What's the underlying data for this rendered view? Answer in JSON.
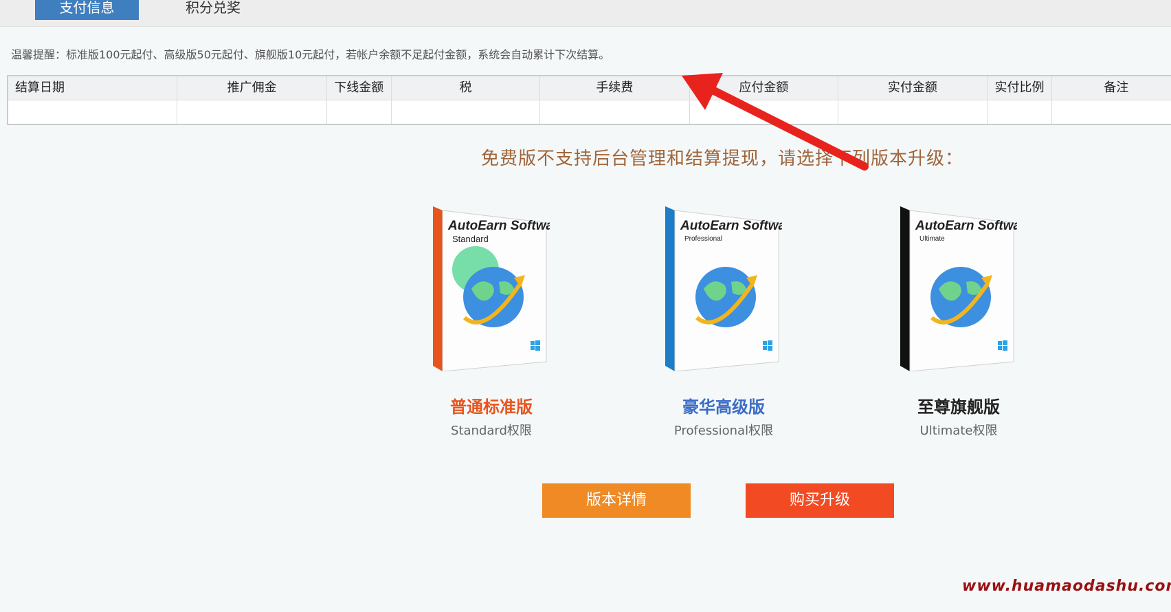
{
  "tabs": {
    "active_label": "支付信息",
    "inactive_label": "积分兑奖"
  },
  "notice": "温馨提醒：标准版100元起付、高级版50元起付、旗舰版10元起付，若帐户余额不足起付金额，系统会自动累计下次结算。",
  "table": {
    "columns": [
      "结算日期",
      "推广佣金",
      "下线金额",
      "税",
      "手续费",
      "应付金额",
      "实付金额",
      "实付比例",
      "备注"
    ]
  },
  "headline": "免费版不支持后台管理和结算提现，请选择下列版本升级：",
  "products": [
    {
      "brand": "AutoEarn Software",
      "edition": "Standard",
      "name": "普通标准版",
      "subtitle": "Standard权限",
      "spine_color": "#e8541e",
      "name_color": "#e8541e"
    },
    {
      "brand": "AutoEarn Software",
      "edition": "Professional",
      "name": "豪华高级版",
      "subtitle": "Professional权限",
      "spine_color": "#1f7cc6",
      "name_color": "#3b6cc7"
    },
    {
      "brand": "AutoEarn Software",
      "edition": "Ultimate",
      "name": "至尊旗舰版",
      "subtitle": "Ultimate权限",
      "spine_color": "#111111",
      "name_color": "#222222"
    }
  ],
  "buttons": {
    "detail_label": "版本详情",
    "buy_label": "购买升级"
  },
  "watermark": "www.huamaodashu.com",
  "colors": {
    "tab_active": "#3f7fbf",
    "detail_button": "#ef8a24",
    "buy_button": "#f24a22",
    "annotation_arrow": "#e8231d",
    "headline": "#a0643a"
  }
}
